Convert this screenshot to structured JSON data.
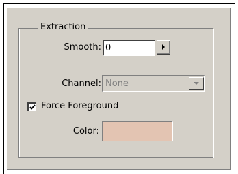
{
  "group": {
    "title": "Extraction"
  },
  "smooth": {
    "label": "Smooth:",
    "value": "0",
    "arrow_icon": "right-triangle-icon"
  },
  "channel": {
    "label": "Channel:",
    "value": "None",
    "enabled": false,
    "arrow_icon": "down-triangle-icon"
  },
  "force_foreground": {
    "label": "Force Foreground",
    "checked": true,
    "check_icon": "checkmark-icon"
  },
  "color": {
    "label": "Color:",
    "swatch_hex": "#e3c4b2"
  }
}
